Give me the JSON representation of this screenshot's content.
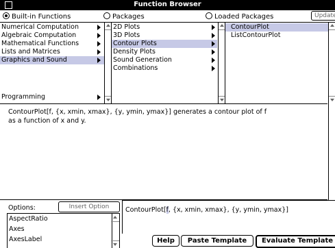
{
  "window": {
    "title": "Function Browser"
  },
  "source_selector": {
    "options": [
      "Built-in Functions",
      "Packages",
      "Loaded Packages"
    ],
    "selected": "Built-in Functions",
    "update_label": "Update"
  },
  "categories": {
    "items": [
      {
        "label": "Numerical Computation",
        "has_children": true
      },
      {
        "label": "Algebraic Computation",
        "has_children": true
      },
      {
        "label": "Mathematical Functions",
        "has_children": true
      },
      {
        "label": "Lists and Matrices",
        "has_children": true
      },
      {
        "label": "Graphics and Sound",
        "has_children": true
      },
      {
        "label": "",
        "has_children": false
      },
      {
        "label": "Programming",
        "has_children": true
      }
    ],
    "selected": "Graphics and Sound"
  },
  "subcategories": {
    "items": [
      {
        "label": "2D Plots",
        "has_children": true
      },
      {
        "label": "3D Plots",
        "has_children": true
      },
      {
        "label": "Contour Plots",
        "has_children": true
      },
      {
        "label": "Density Plots",
        "has_children": true
      },
      {
        "label": "Sound Generation",
        "has_children": true
      },
      {
        "label": "Combinations",
        "has_children": true
      }
    ],
    "selected": "Contour Plots"
  },
  "functions": {
    "items": [
      "ContourPlot",
      "ListContourPlot"
    ],
    "selected": "ContourPlot"
  },
  "description": {
    "line1": "ContourPlot[f, {x, xmin, xmax}, {y, ymin, ymax}] generates a contour plot of f",
    "line2": "as a function of x and y."
  },
  "options": {
    "label": "Options:",
    "insert_label": "Insert Option",
    "items": [
      "AspectRatio",
      "Axes",
      "AxesLabel"
    ]
  },
  "template": {
    "prefix": "ContourPlot[",
    "highlight": "f",
    "suffix": ", {x, xmin, xmax}, {y, ymin, ymax}]"
  },
  "buttons": {
    "help": "Help",
    "paste_template": "Paste Template",
    "evaluate_template": "Evaluate Template"
  },
  "colors": {
    "selection": "#c6c9e6",
    "titlebar": "#000000"
  }
}
